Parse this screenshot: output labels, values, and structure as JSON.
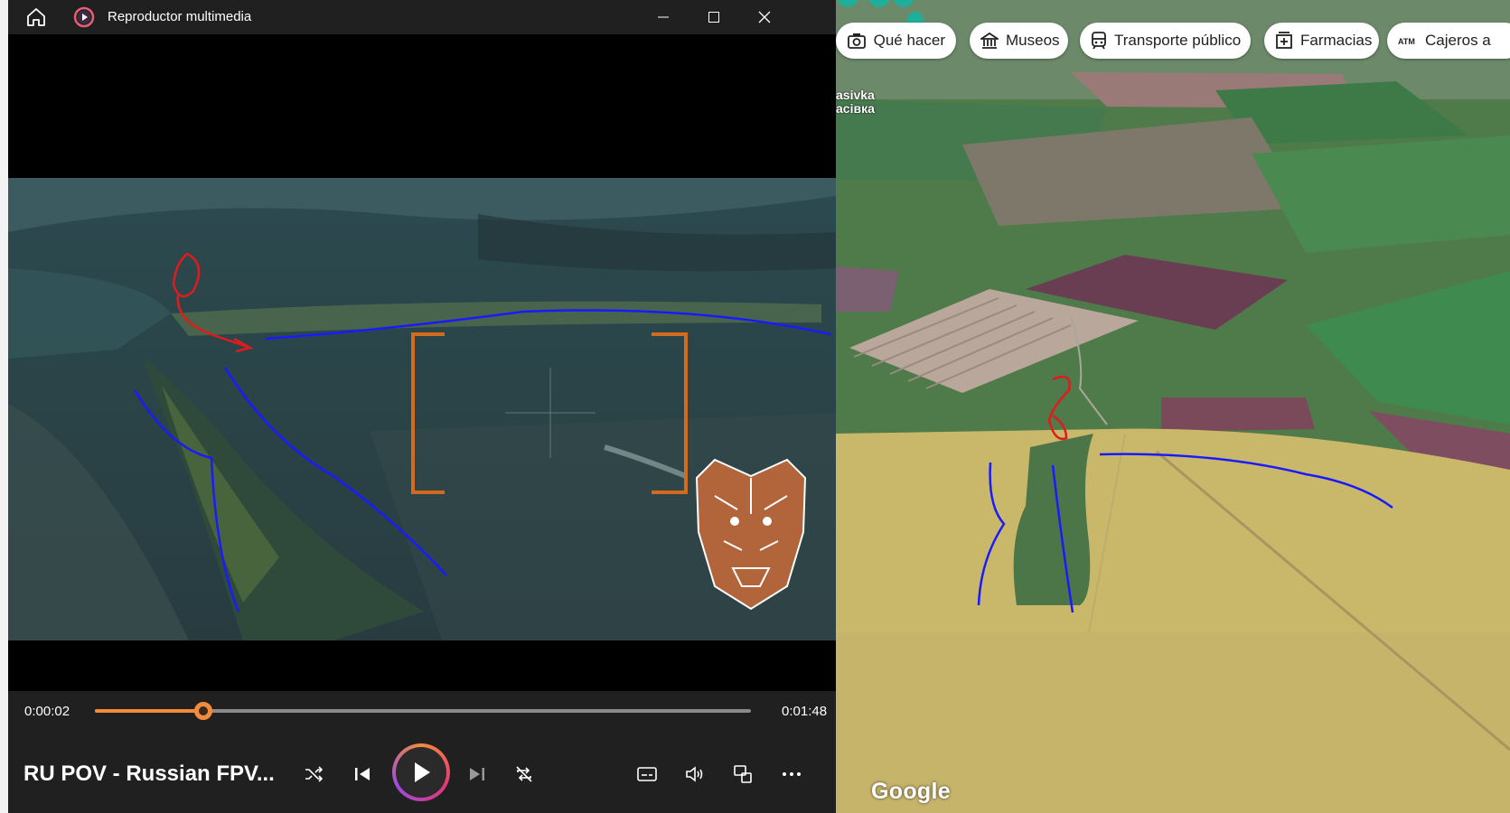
{
  "player": {
    "window_title": "Reproductor multimedia",
    "current_time": "0:00:02",
    "total_time": "0:01:48",
    "progress_fraction": 0.165,
    "media_title": "RU POV - Russian FPV...",
    "accent_color": "#f28b3c",
    "icons": [
      "home-icon",
      "media-player-app-icon",
      "minimize-icon",
      "maximize-icon",
      "close-icon",
      "shuffle-icon",
      "previous-icon",
      "play-icon",
      "next-icon",
      "repeat-icon",
      "subtitles-icon",
      "volume-icon",
      "mini-player-icon",
      "more-options-icon"
    ]
  },
  "maps": {
    "chips": [
      {
        "label": "Qué hacer",
        "icon": "camera-icon"
      },
      {
        "label": "Museos",
        "icon": "museum-icon"
      },
      {
        "label": "Transporte público",
        "icon": "transit-icon"
      },
      {
        "label": "Farmacias",
        "icon": "pharmacy-icon"
      },
      {
        "label": "Cajeros a",
        "icon": "atm-icon"
      }
    ],
    "place_label_line1": "asivka",
    "place_label_line2": "асівка",
    "logo": "Google"
  },
  "annotations": {
    "route_color": "#1a1aff",
    "marker_color": "#e01b1b"
  }
}
